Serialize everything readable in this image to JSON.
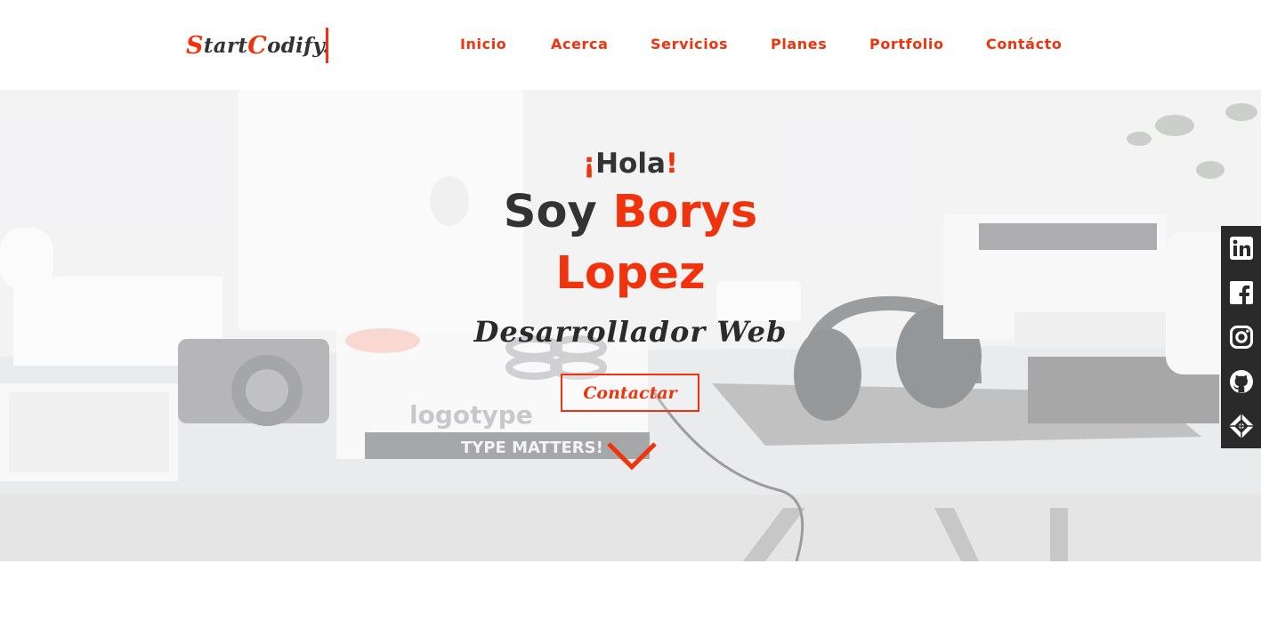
{
  "header": {
    "logo": {
      "first_initial": "S",
      "first_rest": "tart",
      "second_initial": "C",
      "second_rest": "odify."
    },
    "nav": [
      {
        "label": "Inicio"
      },
      {
        "label": "Acerca"
      },
      {
        "label": "Servicios"
      },
      {
        "label": "Planes"
      },
      {
        "label": "Portfolio"
      },
      {
        "label": "Contácto"
      }
    ]
  },
  "hero": {
    "greeting_open": "¡",
    "greeting_word": "Hola",
    "greeting_close": "!",
    "name_prefix": "Soy",
    "first_name": "Borys",
    "last_name": "Lopez",
    "role": "Desarrollador Web",
    "cta_label": "Contactar",
    "scroll_icon": "chevron-down-icon"
  },
  "social": [
    {
      "icon": "linkedin-icon"
    },
    {
      "icon": "facebook-icon"
    },
    {
      "icon": "instagram-icon"
    },
    {
      "icon": "github-icon"
    },
    {
      "icon": "codepen-icon"
    }
  ],
  "colors": {
    "accent": "#f0330c",
    "dark": "#333333",
    "social_bg": "#2a2a2a"
  }
}
